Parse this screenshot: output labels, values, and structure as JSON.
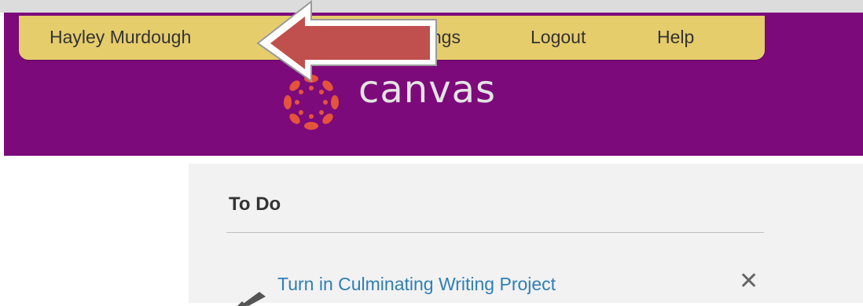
{
  "user_menu": {
    "user_name": "Hayley Murdough",
    "settings_partial": "ttings",
    "logout": "Logout",
    "help": "Help"
  },
  "logo": {
    "text": "canvas",
    "icon": "canvas-logo-icon"
  },
  "todo": {
    "heading": "To Do",
    "items": [
      {
        "title": "Turn in Culminating Writing Project",
        "icon": "pencil-icon",
        "dismiss_icon": "close-icon",
        "dismiss_glyph": "✕"
      }
    ]
  },
  "colors": {
    "header_purple": "#7c0a7a",
    "menu_bar_yellow": "#e6cd6c",
    "logo_red": "#e4533c",
    "arrow_red": "#c0504d",
    "link_blue": "#2f7fb5",
    "panel_gray": "#f2f2f2"
  },
  "annotation": {
    "icon": "arrow-left-icon"
  }
}
